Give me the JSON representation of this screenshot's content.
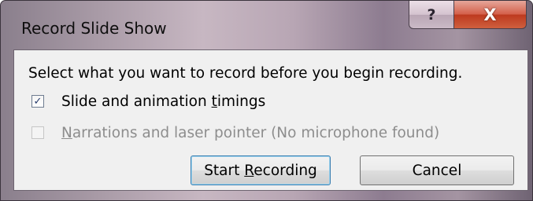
{
  "window": {
    "title": "Record Slide Show"
  },
  "caption": {
    "help_glyph": "?",
    "close_glyph": "X"
  },
  "dialog": {
    "prompt": "Select what you want to record before you begin recording.",
    "options": [
      {
        "label_before": "Slide and animation ",
        "label_mnemonic": "t",
        "label_after": "imings",
        "checked": true,
        "enabled": true,
        "checkmark_glyph": "✓"
      },
      {
        "label_before": "",
        "label_mnemonic": "N",
        "label_after": "arrations and laser pointer (No microphone found)",
        "checked": false,
        "enabled": false
      }
    ],
    "buttons": {
      "start": {
        "label_before": "Start ",
        "label_mnemonic": "R",
        "label_after": "ecording"
      },
      "cancel": {
        "label": "Cancel"
      }
    }
  },
  "colors": {
    "client_background": "#f0f0f0",
    "close_button_red": "#c94a2e",
    "default_button_border": "#3c7fb1",
    "disabled_text": "#8d8d8d"
  },
  "icons": {
    "help": "help-icon",
    "close": "close-icon",
    "check": "checkmark-icon"
  }
}
